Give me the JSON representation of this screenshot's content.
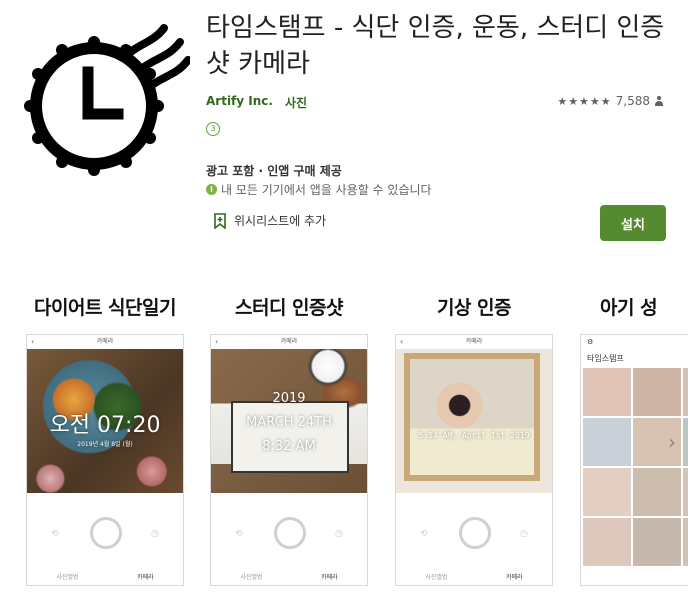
{
  "app": {
    "title": "타임스탬프 - 식단 인증, 운동, 스터디 인증샷 카메라",
    "developer": "Artify Inc.",
    "category": "사진",
    "rating_stars": "★★★★★",
    "rating_value": 4.5,
    "rating_count": "7,588",
    "content_rating": "3",
    "ads_info": "광고 포함 · 인앱 구매 제공",
    "compat_text": "내 모든 기기에서 앱을 사용할 수 있습니다",
    "wishlist_label": "위시리스트에 추가",
    "install_label": "설치",
    "accent_color": "#558b2f"
  },
  "screens": [
    {
      "title": "다이어트 식단일기",
      "header": "카메라",
      "overlay_big": "오전 07:20",
      "overlay_small": "2019년 4월 8일 (월)",
      "tab_left": "사진앨범",
      "tab_right": "카메라"
    },
    {
      "title": "스터디 인증샷",
      "header": "카메라",
      "overlay_l1": "2019",
      "overlay_l2": "MARCH 24TH",
      "overlay_l3": "8:32 AM",
      "tab_left": "사진앨범",
      "tab_right": "카메라"
    },
    {
      "title": "기상 인증",
      "header": "카메라",
      "overlay_text": "5:14 AM, April 1st 2019",
      "tab_left": "사진앨범",
      "tab_right": "카메라"
    },
    {
      "title": "아기 성",
      "gallery_title": "타임스탬프"
    }
  ]
}
